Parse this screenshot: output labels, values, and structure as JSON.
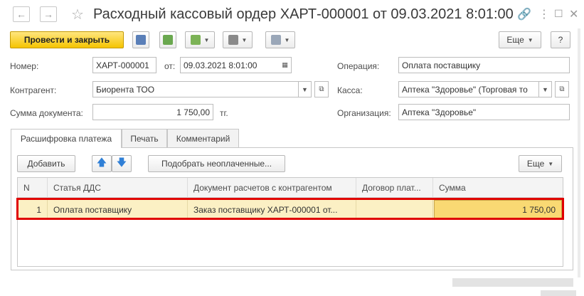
{
  "window": {
    "title": "Расходный кассовый ордер ХАРТ-000001 от 09.03.2021 8:01:00",
    "back_icon": "arrow-left-icon",
    "forward_icon": "arrow-right-icon",
    "favorite_icon": "star-icon",
    "link_icon": "link-icon",
    "menu_icon": "more-vertical-icon",
    "maximize_icon": "maximize-icon",
    "close_icon": "close-icon"
  },
  "toolbar": {
    "post_close_label": "Провести и закрыть",
    "more_label": "Еще",
    "help_label": "?",
    "accent_color": "#f5c400"
  },
  "form": {
    "number_label": "Номер:",
    "number_value": "ХАРТ-000001",
    "from_label": "от:",
    "date_value": "09.03.2021  8:01:00",
    "counterparty_label": "Контрагент:",
    "counterparty_value": "Биорента ТОО",
    "amount_label": "Сумма документа:",
    "amount_value": "1 750,00",
    "currency_label": "тг.",
    "operation_label": "Операция:",
    "operation_value": "Оплата поставщику",
    "cashbox_label": "Касса:",
    "cashbox_value": "Аптека \"Здоровье\" (Торговая то",
    "org_label": "Организация:",
    "org_value": "Аптека \"Здоровье\""
  },
  "tabs": [
    {
      "label": "Расшифровка платежа",
      "active": true
    },
    {
      "label": "Печать",
      "active": false
    },
    {
      "label": "Комментарий",
      "active": false
    }
  ],
  "tab_toolbar": {
    "add_label": "Добавить",
    "pick_unpaid_label": "Подобрать неоплаченные...",
    "more_label": "Еще"
  },
  "table": {
    "columns": [
      "N",
      "Статья ДДС",
      "Документ расчетов с контрагентом",
      "Договор плат...",
      "Сумма"
    ],
    "rows": [
      {
        "n": "1",
        "article": "Оплата поставщику",
        "document": "Заказ поставщику ХАРТ-000001 от...",
        "contract": "",
        "sum": "1 750,00"
      }
    ]
  }
}
